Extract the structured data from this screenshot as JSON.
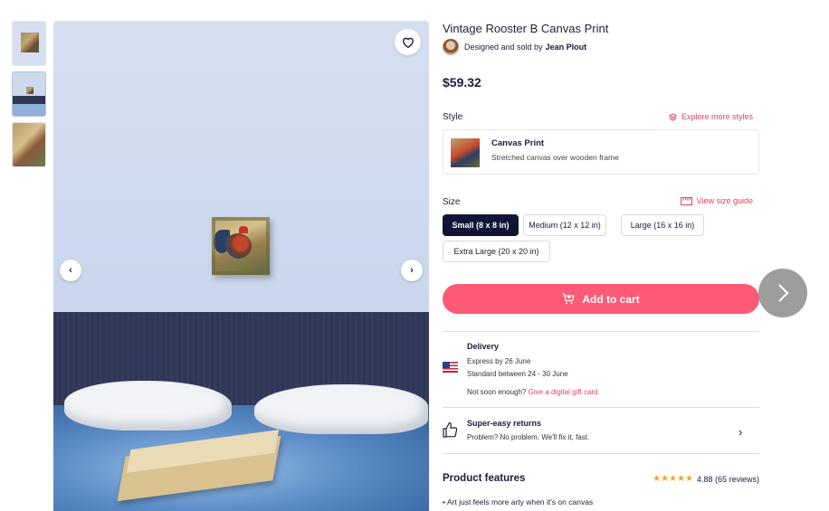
{
  "product": {
    "title": "Vintage Rooster B Canvas Print",
    "designed_by_prefix": "Designed and sold by",
    "designer_name": "Jean Plout",
    "price": "$59.32"
  },
  "style": {
    "label": "Style",
    "explore_link": "Explore more styles",
    "selected_name": "Canvas Print",
    "selected_desc": "Stretched canvas over wooden frame"
  },
  "size": {
    "label": "Size",
    "guide_link": "View size guide",
    "options": [
      "Small (8 x 8 in)",
      "Medium (12 x 12 in)",
      "Large (16 x 16 in)",
      "Extra Large (20 x 20 in)"
    ],
    "selected": "Small (8 x 8 in)"
  },
  "cart": {
    "label": "Add to cart"
  },
  "delivery": {
    "title": "Delivery",
    "express": "Express by 26 June",
    "standard": "Standard between 24 - 30 June",
    "not_soon": "Not soon enough?",
    "gift_link": "Give a digital gift card."
  },
  "returns": {
    "title": "Super-easy returns",
    "desc": "Problem? No problem. We'll fix it, fast."
  },
  "features": {
    "title": "Product features",
    "stars": "★★★★★",
    "rating": "4.88 (65 reviews)",
    "bullets": [
      "Art just feels more arty when it's on canvas"
    ]
  },
  "icons": {
    "favorite": "heart-icon",
    "prev": "chevron-left-icon",
    "next": "chevron-right-icon",
    "explore": "layers-icon",
    "ruler": "ruler-icon",
    "cart": "cart-icon",
    "flag": "us-flag-icon",
    "returns": "thumbs-up-icon"
  },
  "colors": {
    "accent": "#ff5a75",
    "link": "#e4405f",
    "selected_size": "#111436"
  }
}
